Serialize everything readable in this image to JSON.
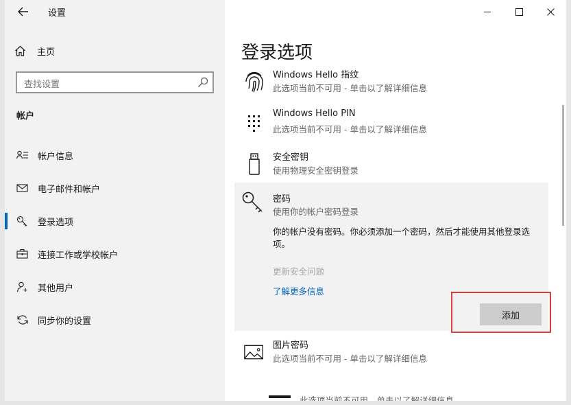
{
  "window": {
    "title": "设置",
    "controls": [
      "minimize",
      "maximize",
      "close"
    ]
  },
  "sidebar": {
    "home_label": "主页",
    "search_placeholder": "查找设置",
    "section_title": "帐户",
    "items": [
      {
        "label": "帐户信息",
        "icon": "person-list-icon",
        "selected": false
      },
      {
        "label": "电子邮件和帐户",
        "icon": "mail-icon",
        "selected": false
      },
      {
        "label": "登录选项",
        "icon": "key-icon",
        "selected": true
      },
      {
        "label": "连接工作或学校帐户",
        "icon": "briefcase-icon",
        "selected": false
      },
      {
        "label": "其他用户",
        "icon": "add-person-icon",
        "selected": false
      },
      {
        "label": "同步你的设置",
        "icon": "sync-icon",
        "selected": false
      }
    ]
  },
  "main": {
    "title": "登录选项",
    "options": [
      {
        "name": "Windows Hello 指纹",
        "desc": "此选项当前不可用 - 单击以了解详细信息",
        "icon": "fingerprint-icon"
      },
      {
        "name": "Windows Hello PIN",
        "desc": "此选项当前不可用 - 单击以了解详细信息",
        "icon": "pin-keypad-icon"
      },
      {
        "name": "安全密钥",
        "desc": "使用物理安全密钥登录",
        "icon": "usb-key-icon"
      }
    ],
    "password": {
      "name": "密码",
      "desc": "使用你的帐户密码登录",
      "message": "你的帐户没有密码。你必须添加一个密码，然后才能使用其他登录选项。",
      "update_link": "更新安全问题",
      "learn_link": "了解更多信息",
      "add_button": "添加",
      "icon": "key-icon"
    },
    "picture_password": {
      "name": "图片密码",
      "desc": "此选项当前不可用 - 单击以了解详细信息",
      "icon": "picture-icon"
    },
    "next_peek_desc": "此选项当前不可用 - 单击以了解详细信息"
  },
  "colors": {
    "accent": "#0067c0",
    "highlight": "#e03c3c",
    "sidebar_bg": "#f2f2f2",
    "button_bg": "#cccccc"
  }
}
